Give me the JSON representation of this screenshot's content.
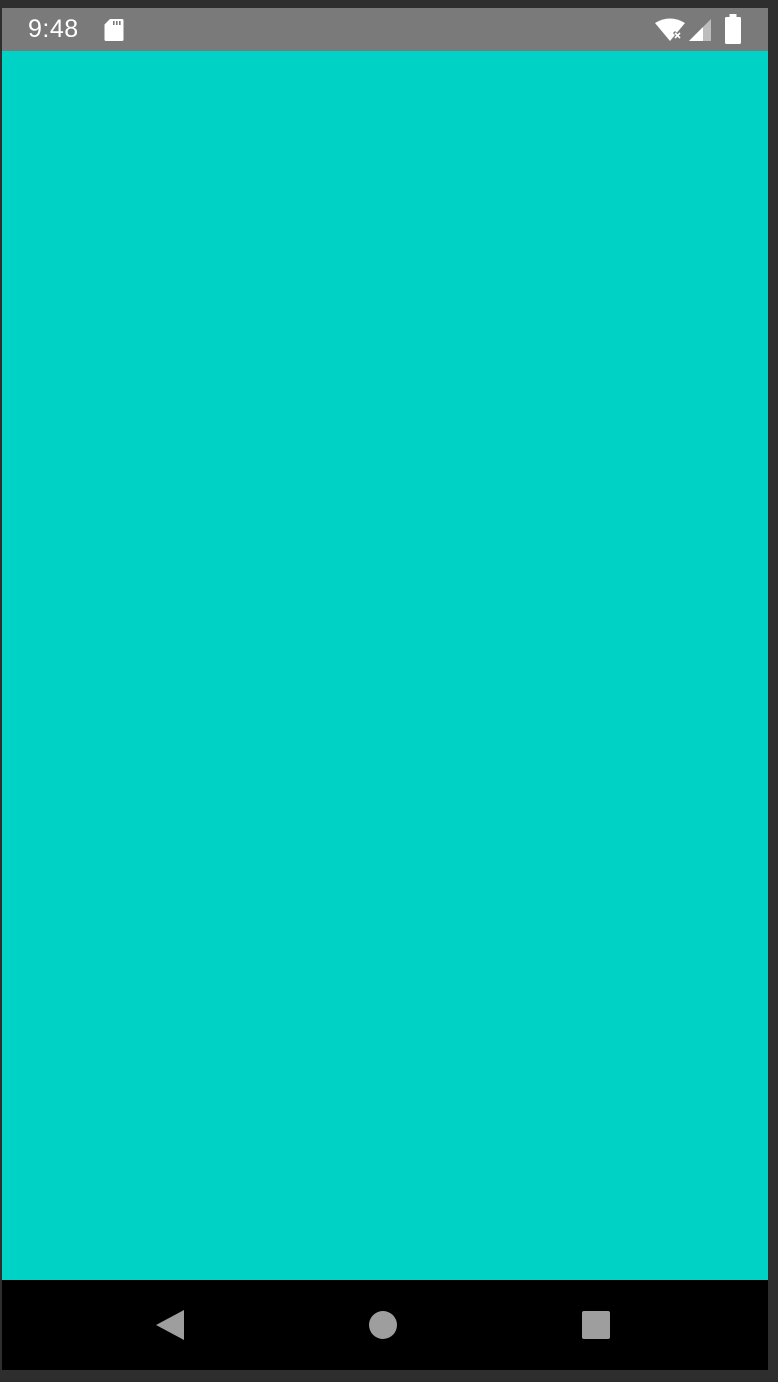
{
  "status_bar": {
    "time": "9:48",
    "icons": [
      "sd-card-icon",
      "wifi-icon",
      "signal-icon",
      "battery-icon"
    ],
    "background_color": "#7a7a7a"
  },
  "app": {
    "background_color": "#00d3c6"
  },
  "nav_bar": {
    "icons": [
      "back-icon",
      "home-icon",
      "recents-icon"
    ],
    "icon_color": "#9e9e9e"
  }
}
